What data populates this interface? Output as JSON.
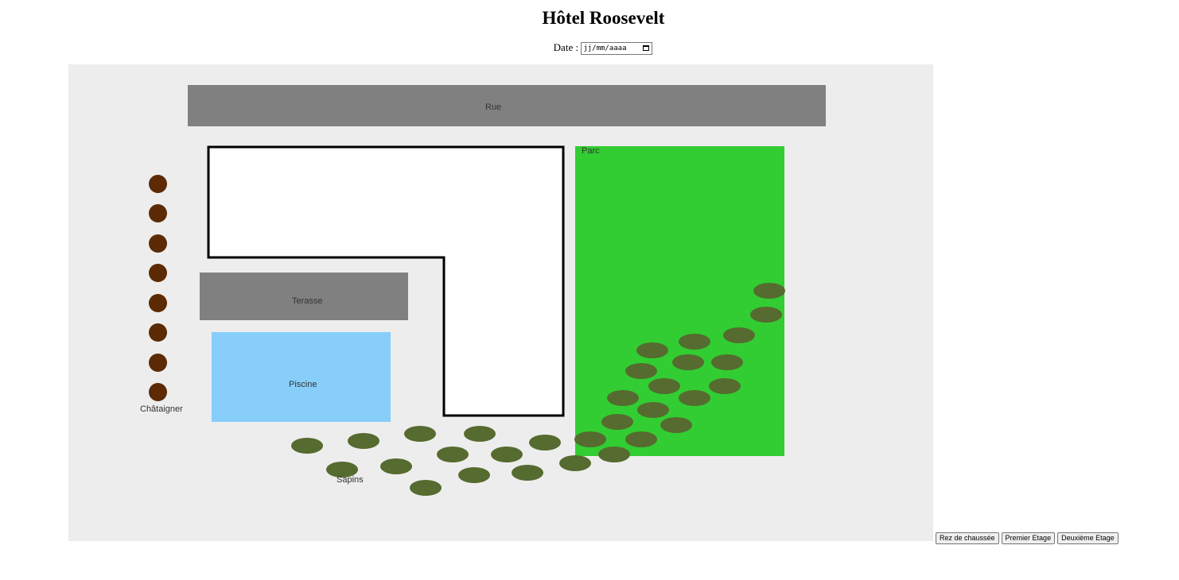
{
  "header": {
    "title": "Hôtel Roosevelt",
    "date_label": "Date :",
    "date_placeholder": "jj/mm/aaaa"
  },
  "map": {
    "rue_label": "Rue",
    "parc_label": "Parc",
    "terasse_label": "Terasse",
    "piscine_label": "Piscine",
    "chataigner_label": "Châtaigner",
    "sapins_label": "Sapins",
    "colors": {
      "background": "#ededed",
      "rue": "#808080",
      "terasse": "#808080",
      "parc": "#32cd32",
      "piscine": "#87cefa",
      "chataigner": "#5c2a04",
      "sapin": "#556b2f",
      "hotel": "#ffffff"
    }
  },
  "floors": {
    "ground_label": "Rez de chaussée",
    "first_label": "Premier Etage",
    "second_label": "Deuxième Etage"
  }
}
